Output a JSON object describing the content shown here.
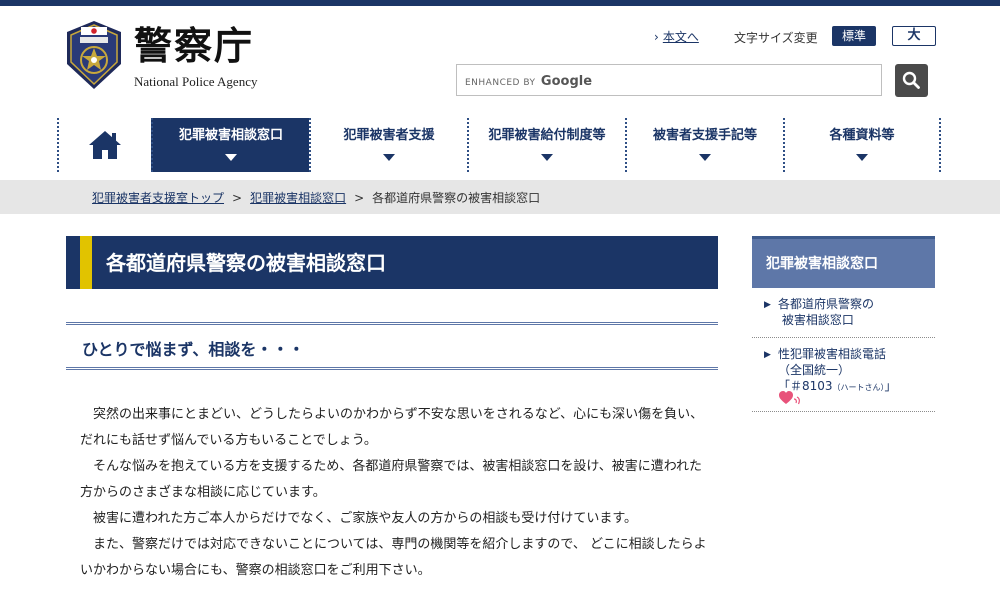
{
  "header": {
    "logo_title": "警察庁",
    "logo_subtitle": "National Police Agency",
    "skip_link": "本文へ",
    "font_size_label": "文字サイズ変更",
    "font_size_normal": "標準",
    "font_size_large": "大",
    "search_placeholder_prefix": "ENHANCED BY",
    "search_placeholder_brand": "Google"
  },
  "nav": {
    "items": [
      {
        "label": "犯罪被害相談窓口",
        "active": true
      },
      {
        "label": "犯罪被害者支援"
      },
      {
        "label": "犯罪被害給付制度等"
      },
      {
        "label": "被害者支援手記等"
      },
      {
        "label": "各種資料等"
      }
    ]
  },
  "breadcrumb": {
    "items": [
      "犯罪被害者支援室トップ",
      "犯罪被害相談窓口",
      "各都道府県警察の被害相談窓口"
    ],
    "separator": ">"
  },
  "main": {
    "title": "各都道府県警察の被害相談窓口",
    "subheading": "ひとりで悩まず、相談を・・・",
    "paragraphs": [
      "突然の出来事にとまどい、どうしたらよいのかわからず不安な思いをされるなど、心にも深い傷を負い、だれにも話せず悩んでいる方もいることでしょう。",
      "そんな悩みを抱えている方を支援するため、各都道府県警察では、被害相談窓口を設け、被害に遭われた方からのさまざまな相談に応じています。",
      "被害に遭われた方ご本人からだけでなく、ご家族や友人の方からの相談も受け付けています。",
      "また、警察だけでは対応できないことについては、専門の機関等を紹介しますので、 どこに相談したらよいかわからない場合にも、警察の相談窓口をご利用下さい。"
    ]
  },
  "sidebar": {
    "heading": "犯罪被害相談窓口",
    "link1_line1": "各都道府県警察の",
    "link1_line2": "被害相談窓口",
    "link2_line1": "性犯罪被害相談電話",
    "link2_line2": "（全国統一）",
    "link2_number": "「＃8103",
    "link2_reading": "（ハートさん）",
    "link2_close": "」"
  },
  "colors": {
    "navy": "#1b3566",
    "accent_yellow": "#e1c300",
    "sidebar_blue": "#5e77a8",
    "breadcrumb_bg": "#e6e6e6"
  }
}
